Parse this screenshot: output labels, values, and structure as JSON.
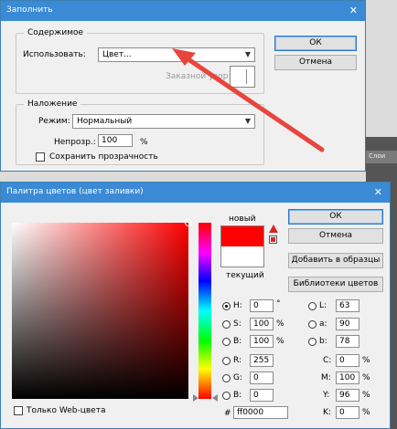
{
  "fill_dialog": {
    "title": "Заполнить",
    "content_group": "Содержимое",
    "use_label": "Использовать:",
    "use_value": "Цвет...",
    "custom_pattern_label": "Заказной узор:",
    "blending_group": "Наложение",
    "mode_label": "Режим:",
    "mode_value": "Нормальный",
    "opacity_label": "Непрозр.:",
    "opacity_value": "100",
    "opacity_unit": "%",
    "preserve_transparency_label": "Сохранить прозрачность",
    "ok_label": "ОК",
    "cancel_label": "Отмена"
  },
  "background_panel": {
    "tab_label": "Слои"
  },
  "color_picker": {
    "title": "Палитра цветов (цвет заливки)",
    "new_label": "новый",
    "current_label": "текущий",
    "new_color": "#ff0000",
    "current_color": "#ffffff",
    "ok_label": "ОК",
    "cancel_label": "Отмена",
    "add_to_swatches_label": "Добавить в образцы",
    "color_libraries_label": "Библиотеки цветов",
    "web_colors_label": "Только Web-цвета",
    "hsb": [
      {
        "key": "H:",
        "value": "0",
        "unit": "°",
        "selected": true
      },
      {
        "key": "S:",
        "value": "100",
        "unit": "%",
        "selected": false
      },
      {
        "key": "B:",
        "value": "100",
        "unit": "%",
        "selected": false
      }
    ],
    "rgb": [
      {
        "key": "R:",
        "value": "255"
      },
      {
        "key": "G:",
        "value": "0"
      },
      {
        "key": "B:",
        "value": "0"
      }
    ],
    "lab": [
      {
        "key": "L:",
        "value": "63"
      },
      {
        "key": "a:",
        "value": "90"
      },
      {
        "key": "b:",
        "value": "78"
      }
    ],
    "cmyk": [
      {
        "key": "C:",
        "value": "0",
        "unit": "%"
      },
      {
        "key": "M:",
        "value": "100",
        "unit": "%"
      },
      {
        "key": "Y:",
        "value": "96",
        "unit": "%"
      },
      {
        "key": "K:",
        "value": "0",
        "unit": "%"
      }
    ],
    "hex_label": "#",
    "hex_value": "ff0000"
  },
  "colors": {
    "title_bar": "#3a8ad5",
    "annotation_arrow": "#e8453c"
  }
}
